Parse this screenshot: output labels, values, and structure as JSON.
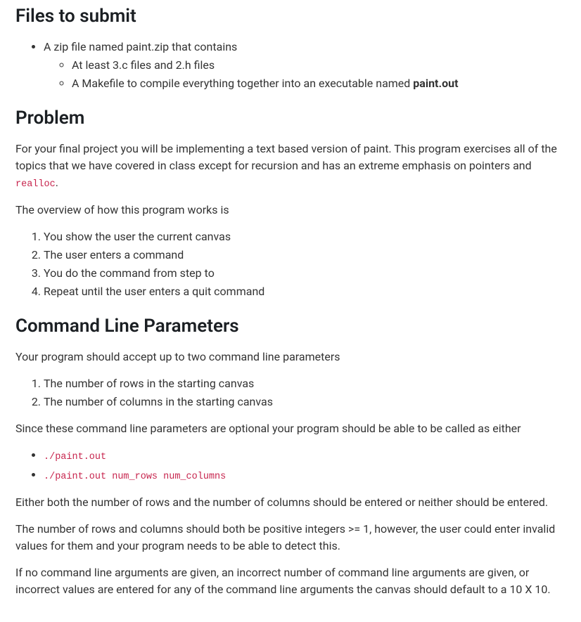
{
  "files": {
    "heading": "Files to submit",
    "bullet1": "A zip file named paint.zip that contains",
    "sub1": "At least 3.c files and 2.h files",
    "sub2_pre": "A Makefile to compile everything together into an executable named ",
    "sub2_bold": "paint.out"
  },
  "problem": {
    "heading": "Problem",
    "p1_pre": "For your final project you will be implementing a text based version of paint. This program exercises all of the topics that we have covered in class except for recursion and has an extreme emphasis on pointers and ",
    "p1_code": "realloc",
    "p1_post": ".",
    "p2": "The overview of how this program works is",
    "steps": {
      "s1": "You show the user the current canvas",
      "s2": "The user enters a command",
      "s3": "You do the command from step to",
      "s4": "Repeat until the user enters a quit command"
    }
  },
  "cli": {
    "heading": "Command Line Parameters",
    "p1": "Your program should accept up to two command line parameters",
    "params": {
      "r": "The number of rows in the starting canvas",
      "c": "The number of columns in the starting canvas"
    },
    "p2": "Since these command line parameters are optional your program should be able to be called as either",
    "calls": {
      "c1": "./paint.out",
      "c2": "./paint.out num_rows num_columns"
    },
    "p3": "Either both the number of rows and the number of columns should be entered or neither should be entered.",
    "p4": "The number of rows and columns should both be positive integers >= 1, however, the user could enter invalid values for them and your program needs to be able to detect this.",
    "p5": "If no command line arguments are given, an incorrect number of command line arguments are given, or incorrect values are entered for any of the command line arguments the canvas should default to a 10 X 10."
  }
}
